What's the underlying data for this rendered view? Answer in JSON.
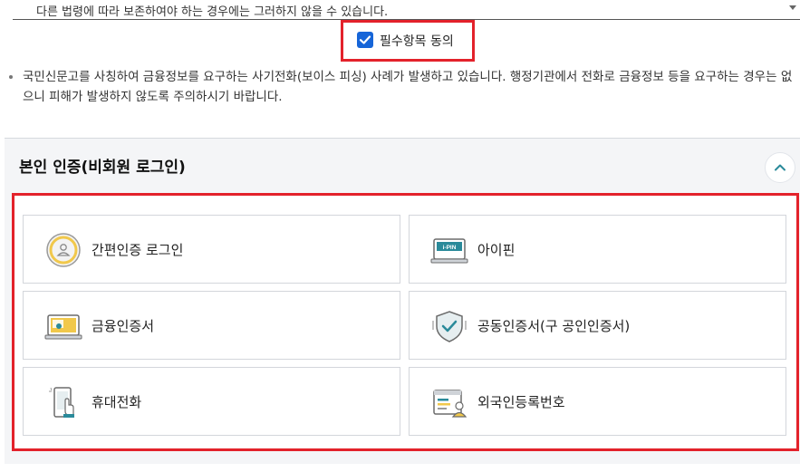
{
  "terms": {
    "text": "다른 법령에 따라 보존하여야 하는 경우에는 그러하지 않을 수 있습니다."
  },
  "agreement": {
    "label": "필수항목 동의",
    "checked": true
  },
  "notice": {
    "text": "국민신문고를 사칭하여 금융정보를 요구하는 사기전화(보이스 피싱) 사례가 발생하고 있습니다. 행정기관에서 전화로 금융정보 등을 요구하는 경우는 없으니 피해가 발생하지 않도록 주의하시기 바랍니다."
  },
  "auth_section": {
    "title": "본인 인증(비회원 로그인)",
    "methods": [
      {
        "label": "간편인증 로그인",
        "icon": "simple-auth-icon"
      },
      {
        "label": "아이핀",
        "icon": "ipin-icon",
        "icon_text": "i-PIN"
      },
      {
        "label": "금융인증서",
        "icon": "financial-certificate-icon"
      },
      {
        "label": "공동인증서(구 공인인증서)",
        "icon": "joint-certificate-icon"
      },
      {
        "label": "휴대전화",
        "icon": "mobile-phone-icon"
      },
      {
        "label": "외국인등록번호",
        "icon": "foreigner-registration-icon"
      }
    ]
  },
  "colors": {
    "highlight_red": "#e3222b",
    "checkbox_blue": "#1665d8",
    "section_bg": "#f4f5f7",
    "icon_teal": "#2a8a9a",
    "icon_yellow": "#f1c84b"
  }
}
